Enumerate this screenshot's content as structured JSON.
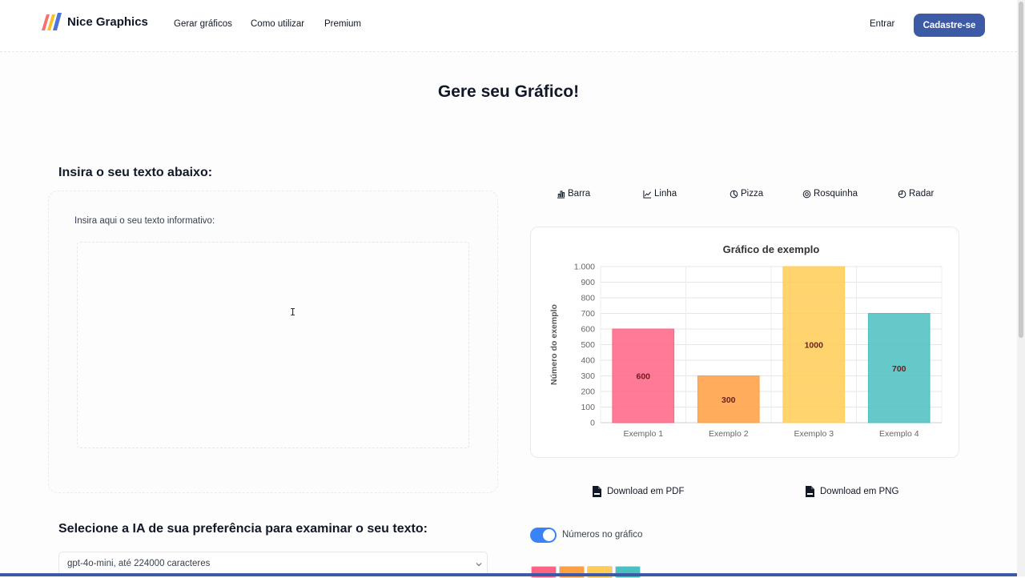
{
  "brand": {
    "name": "Nice Graphics"
  },
  "nav": {
    "links": [
      "Gerar gráficos",
      "Como utilizar",
      "Premium"
    ],
    "login": "Entrar",
    "signup": "Cadastre-se"
  },
  "page_title": "Gere seu Gráfico!",
  "text_section": {
    "heading": "Insira o seu texto abaixo:",
    "label": "Insira aqui o seu texto informativo:",
    "value": ""
  },
  "chart_types": [
    {
      "label": "Barra",
      "icon": "bar-chart-icon"
    },
    {
      "label": "Linha",
      "icon": "line-chart-icon"
    },
    {
      "label": "Pizza",
      "icon": "pie-chart-icon"
    },
    {
      "label": "Rosquinha",
      "icon": "donut-chart-icon"
    },
    {
      "label": "Radar",
      "icon": "radar-chart-icon"
    }
  ],
  "chart_data": {
    "type": "bar",
    "title": "Gráfico de exemplo",
    "xlabel": "",
    "ylabel": "Número do exemplo",
    "categories": [
      "Exemplo 1",
      "Exemplo 2",
      "Exemplo 3",
      "Exemplo 4"
    ],
    "values": [
      600,
      300,
      1000,
      700
    ],
    "colors": [
      "#ff6384",
      "#ff9f40",
      "#ffcd56",
      "#4bc0c0"
    ],
    "ylim": [
      0,
      1000
    ],
    "yticks": [
      0,
      100,
      200,
      300,
      400,
      500,
      600,
      700,
      800,
      900,
      1000
    ],
    "ytick_labels": [
      "0",
      "100",
      "200",
      "300",
      "400",
      "500",
      "600",
      "700",
      "800",
      "900",
      "1.000"
    ],
    "data_labels": [
      "600",
      "300",
      "1000",
      "700"
    ],
    "grid": true,
    "legend": "none"
  },
  "downloads": {
    "pdf": "Download em PDF",
    "png": "Download em PNG"
  },
  "toggle": {
    "label": "Números no gráfico",
    "on": true
  },
  "ai_section": {
    "heading": "Selecione a IA de sua preferência para examinar o seu texto:",
    "selected": "gpt-4o-mini, até 224000 caracteres"
  },
  "color_swatches": [
    "#ff6384",
    "#ff9f40",
    "#ffcd56",
    "#4bc0c0"
  ],
  "theme": {
    "accent": "#3d5aa6",
    "toggle": "#3b82f6"
  }
}
